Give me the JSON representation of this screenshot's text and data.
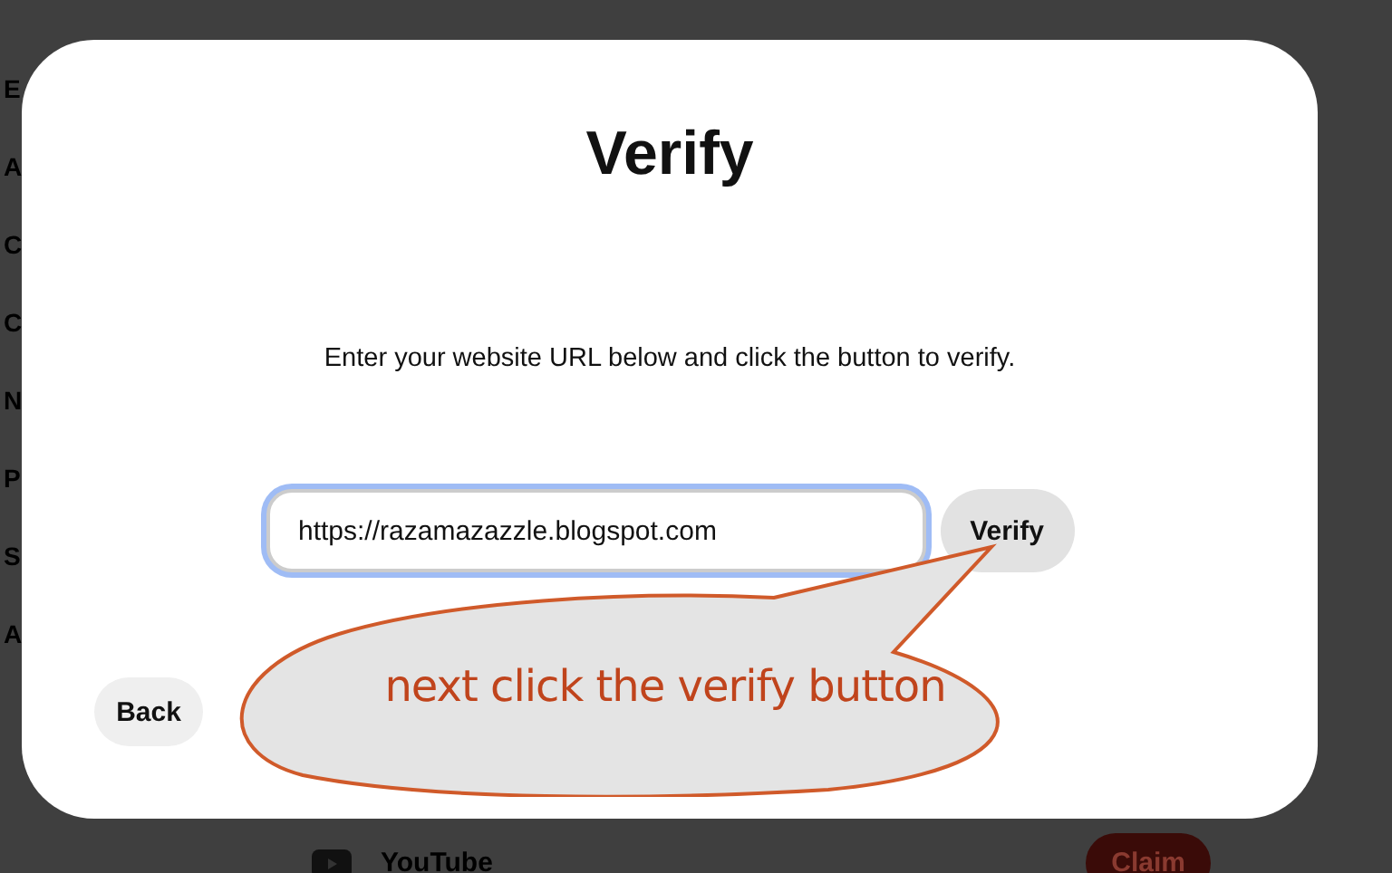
{
  "background": {
    "sidebar_letters": [
      "E",
      "A",
      "C",
      "C",
      "N",
      "P",
      "S",
      "A"
    ],
    "row": {
      "label": "YouTube",
      "button": "Claim"
    }
  },
  "dialog": {
    "title": "Verify",
    "description": "Enter your website URL below and click the button to verify.",
    "url_field": {
      "value": "https://razamazazzle.blogspot.com",
      "focused": true
    },
    "verify_button": "Verify",
    "back_button": "Back"
  },
  "callout": {
    "text": "next click the verify button"
  }
}
